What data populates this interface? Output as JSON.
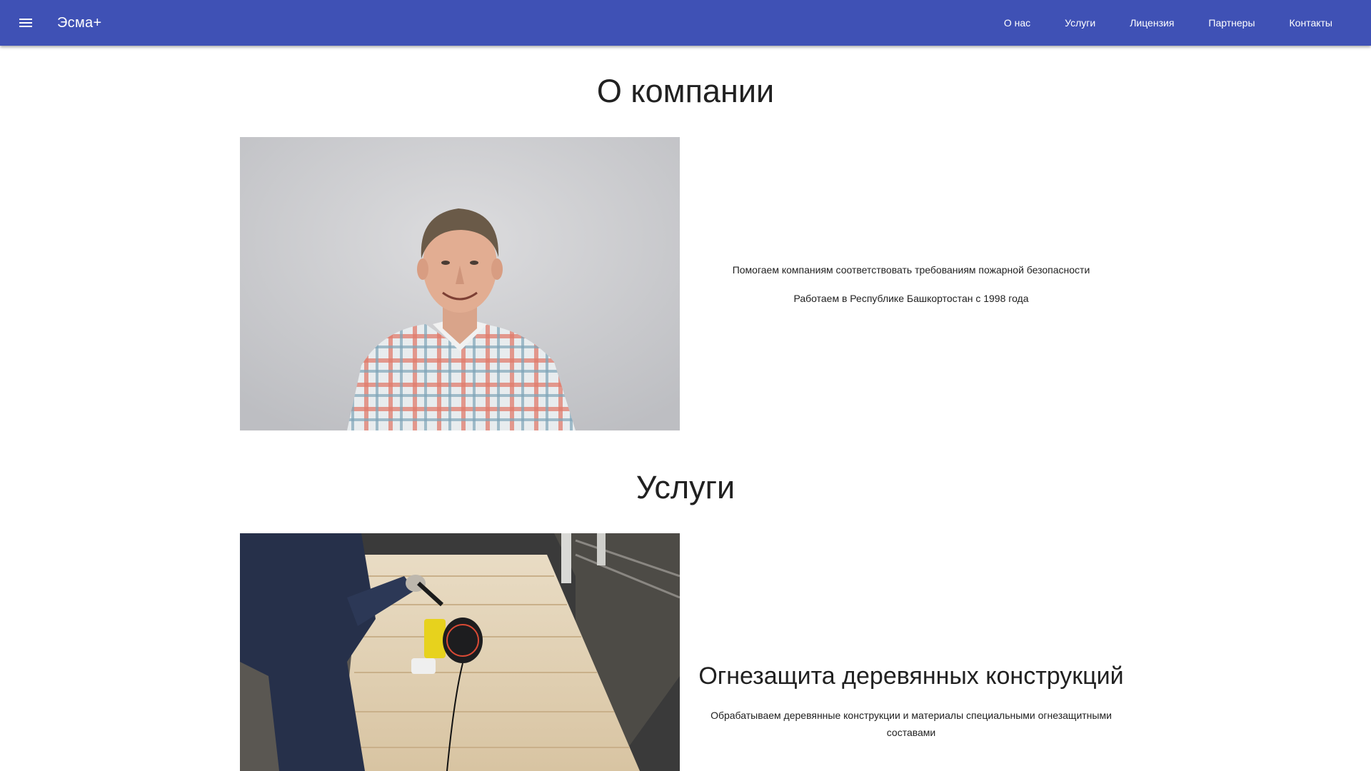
{
  "appbar": {
    "brand": "Эсма+",
    "menu_icon": "menu-icon",
    "color": "#3f51b5",
    "nav": [
      {
        "label": "О нас"
      },
      {
        "label": "Услуги"
      },
      {
        "label": "Лицензия"
      },
      {
        "label": "Партнеры"
      },
      {
        "label": "Контакты"
      }
    ]
  },
  "about": {
    "title": "О компании",
    "photo": "photo-portrait",
    "lines": [
      "Помогаем компаниям соответствовать требованиям пожарной безопасности",
      "Работаем в Республике Башкортостан с 1998 года"
    ]
  },
  "services": {
    "title": "Услуги",
    "items": [
      {
        "photo": "photo-wood-treatment",
        "heading": "Огнезащита деревянных конструкций",
        "description": "Обрабатываем деревянные конструкции и материалы специальными огнезащитными составами"
      }
    ]
  }
}
